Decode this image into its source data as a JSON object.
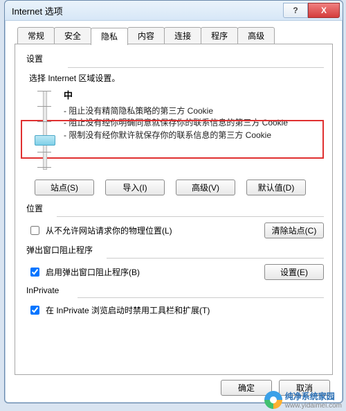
{
  "window": {
    "title": "Internet 选项",
    "help_btn": "?",
    "close_btn": "X"
  },
  "tabs": [
    {
      "label": "常规",
      "active": false
    },
    {
      "label": "安全",
      "active": false
    },
    {
      "label": "隐私",
      "active": true
    },
    {
      "label": "内容",
      "active": false
    },
    {
      "label": "连接",
      "active": false
    },
    {
      "label": "程序",
      "active": false
    },
    {
      "label": "高级",
      "active": false
    }
  ],
  "privacy": {
    "section_label": "设置",
    "zone_text": "选择 Internet 区域设置。",
    "level_label": "中",
    "desc1": "- 阻止没有精简隐私策略的第三方 Cookie",
    "desc2": "- 阻止没有经你明确同意就保存你的联系信息的第三方 Cookie",
    "desc3": "- 限制没有经你默许就保存你的联系信息的第三方 Cookie",
    "buttons": {
      "sites": "站点(S)",
      "import": "导入(I)",
      "advanced": "高级(V)",
      "default": "默认值(D)"
    }
  },
  "location": {
    "section_label": "位置",
    "checkbox_label": "从不允许网站请求你的物理位置(L)",
    "checked": false,
    "clear_btn": "清除站点(C)"
  },
  "popup": {
    "section_label": "弹出窗口阻止程序",
    "checkbox_label": "启用弹出窗口阻止程序(B)",
    "checked": true,
    "settings_btn": "设置(E)"
  },
  "inprivate": {
    "section_label": "InPrivate",
    "checkbox_label": "在 InPrivate 浏览启动时禁用工具栏和扩展(T)",
    "checked": true
  },
  "dialog_buttons": {
    "ok": "确定",
    "cancel": "取消"
  },
  "watermark": {
    "text": "纯净系统家园",
    "url": "www.yidaimei.com"
  }
}
